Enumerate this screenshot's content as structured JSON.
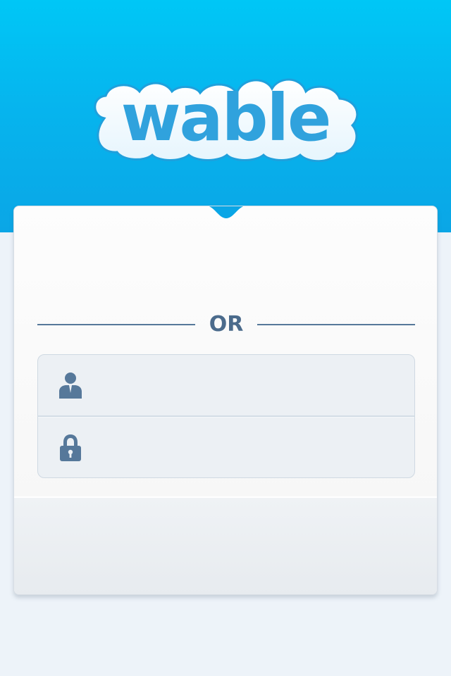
{
  "brand": {
    "logo_text": "wable"
  },
  "divider": {
    "label": "OR"
  },
  "login_form": {
    "username": {
      "icon": "user-icon",
      "value": "",
      "placeholder": ""
    },
    "password": {
      "icon": "lock-icon",
      "value": "",
      "placeholder": ""
    }
  },
  "colors": {
    "header_top": "#00c7f6",
    "header_bottom": "#0aa6e6",
    "logo_text": "#30a2dd",
    "divider": "#56789a",
    "icon": "#56789a",
    "background": "#edf3f9"
  }
}
